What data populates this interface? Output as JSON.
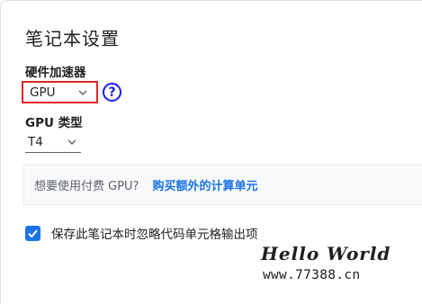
{
  "dialog": {
    "title": "笔记本设置"
  },
  "hardware_accelerator": {
    "label": "硬件加速器",
    "selected": "GPU",
    "help_symbol": "?"
  },
  "gpu_type": {
    "label": "GPU 类型",
    "selected": "T4"
  },
  "upsell": {
    "question": "想要使用付费 GPU?",
    "link": "购买额外的计算单元"
  },
  "omit_output": {
    "label": "保存此笔记本时忽略代码单元格输出项",
    "checked": true
  },
  "watermark": {
    "logo": "Hello World",
    "url": "www.77388.cn"
  },
  "colors": {
    "accent": "#1a73e8",
    "highlight_border": "#e02424",
    "help_icon": "#1a1aef"
  },
  "icons": [
    "chevron-down-icon",
    "help-circle-icon",
    "checkmark-icon"
  ]
}
